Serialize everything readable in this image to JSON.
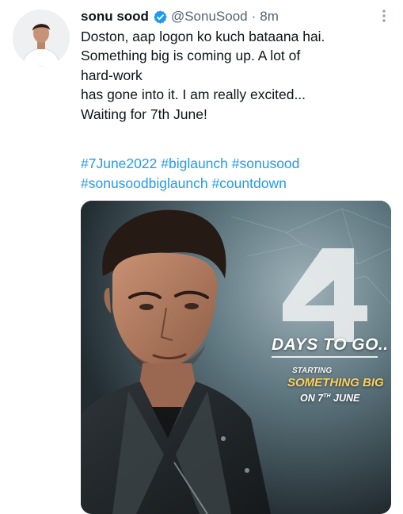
{
  "tweet": {
    "author_name": "sonu sood",
    "handle": "@SonuSood",
    "separator": "·",
    "timestamp": "8m",
    "text_lines": [
      "Doston, aap logon ko kuch bataana hai.",
      "Something big is coming up. A lot of",
      "hard-work",
      "has gone into it. I am really excited...",
      "Waiting for 7th June!"
    ],
    "hashtags": [
      "#7June2022",
      "#biglaunch",
      "#sonusood",
      "#sonusoodbiglaunch",
      "#countdown"
    ]
  },
  "media": {
    "big_number": "4",
    "days_text": "DAYS TO GO..",
    "starting": "STARTING",
    "something_big": "SOMETHING BIG",
    "on_prefix": "ON 7",
    "on_sup": "TH",
    "on_suffix": " JUNE"
  },
  "icons": {
    "verified": "verified-badge-icon",
    "more": "more-vertical-icon"
  },
  "colors": {
    "link": "#1d9bf0",
    "text": "#0f1419",
    "muted": "#536471",
    "verified": "#1d9bf0",
    "poster_accent": "#ffcf5a"
  }
}
